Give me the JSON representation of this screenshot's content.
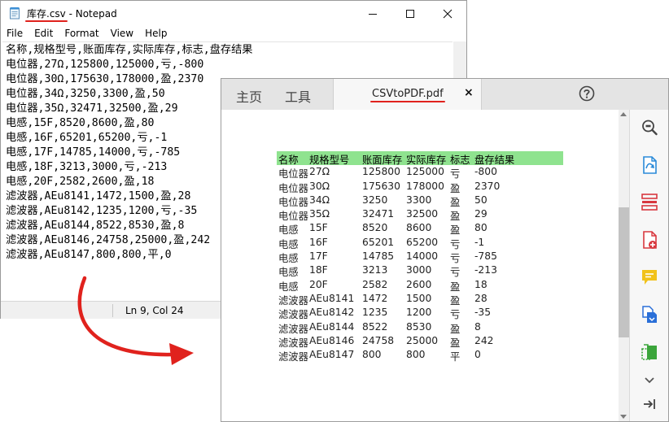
{
  "notepad": {
    "title_filename": "库存.csv",
    "title_suffix": " - Notepad",
    "menu": [
      "File",
      "Edit",
      "Format",
      "View",
      "Help"
    ],
    "lines": [
      "名称,规格型号,账面库存,实际库存,标志,盘存结果",
      "电位器,27Ω,125800,125000,亏,-800",
      "电位器,30Ω,175630,178000,盈,2370",
      "电位器,34Ω,3250,3300,盈,50",
      "电位器,35Ω,32471,32500,盈,29",
      "电感,15F,8520,8600,盈,80",
      "电感,16F,65201,65200,亏,-1",
      "电感,17F,14785,14000,亏,-785",
      "电感,18F,3213,3000,亏,-213",
      "电感,20F,2582,2600,盈,18",
      "滤波器,AEu8141,1472,1500,盈,28",
      "滤波器,AEu8142,1235,1200,亏,-35",
      "滤波器,AEu8144,8522,8530,盈,8",
      "滤波器,AEu8146,24758,25000,盈,242",
      "滤波器,AEu8147,800,800,平,0"
    ],
    "status_position": "Ln 9, Col 24"
  },
  "viewer": {
    "tabs": [
      "主页",
      "工具"
    ],
    "document_tab": "CSVtoPDF.pdf",
    "close_glyph": "×",
    "table": {
      "header": [
        "名称",
        "规格型号",
        "账面库存",
        "实际库存",
        "标志",
        "盘存结果"
      ],
      "rows": [
        [
          "电位器",
          "27Ω",
          "125800",
          "125000",
          "亏",
          "-800"
        ],
        [
          "电位器",
          "30Ω",
          "175630",
          "178000",
          "盈",
          "2370"
        ],
        [
          "电位器",
          "34Ω",
          "3250",
          "3300",
          "盈",
          "50"
        ],
        [
          "电位器",
          "35Ω",
          "32471",
          "32500",
          "盈",
          "29"
        ],
        [
          "电感",
          "15F",
          "8520",
          "8600",
          "盈",
          "80"
        ],
        [
          "电感",
          "16F",
          "65201",
          "65200",
          "亏",
          "-1"
        ],
        [
          "电感",
          "17F",
          "14785",
          "14000",
          "亏",
          "-785"
        ],
        [
          "电感",
          "18F",
          "3213",
          "3000",
          "亏",
          "-213"
        ],
        [
          "电感",
          "20F",
          "2582",
          "2600",
          "盈",
          "18"
        ],
        [
          "滤波器",
          "AEu8141",
          "1472",
          "1500",
          "盈",
          "28"
        ],
        [
          "滤波器",
          "AEu8142",
          "1235",
          "1200",
          "亏",
          "-35"
        ],
        [
          "滤波器",
          "AEu8144",
          "8522",
          "8530",
          "盈",
          "8"
        ],
        [
          "滤波器",
          "AEu8146",
          "24758",
          "25000",
          "盈",
          "242"
        ],
        [
          "滤波器",
          "AEu8147",
          "800",
          "800",
          "平",
          "0"
        ]
      ],
      "header_color": "#8fe38f"
    },
    "tools": [
      "zoom-icon",
      "export-pdf-icon",
      "organize-pages-icon",
      "create-pdf-icon",
      "comment-icon",
      "convert-icon",
      "compress-icon",
      "chevron-down-icon",
      "collapse-panel-icon"
    ]
  },
  "accent_colors": {
    "underline": "#e0221d",
    "arrow": "#e0221d"
  }
}
